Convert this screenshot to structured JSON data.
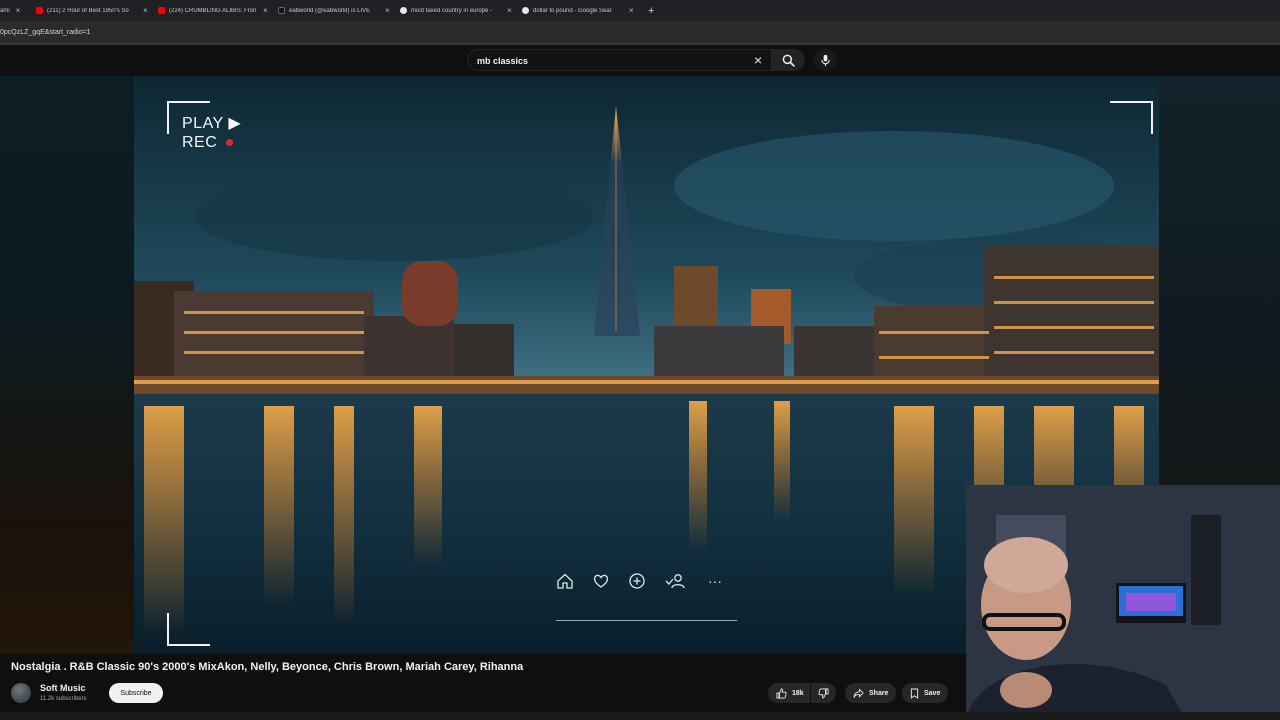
{
  "browser": {
    "tabs": [
      {
        "title": "ami",
        "favicon_color": "#c9c9c9",
        "close": "×"
      },
      {
        "title": "(211) 2 Hour of Best 1950's So",
        "favicon_color": "#ff0000",
        "close": "×"
      },
      {
        "title": "(224) CRUMBLING ALIBIS: Fron",
        "favicon_color": "#ff0000",
        "close": "×"
      },
      {
        "title": "eabworld (@eabworld) is LIVE",
        "favicon_color": "#111111",
        "close": "×"
      },
      {
        "title": "most taxed country in europe -",
        "favicon_color": "#e8e8e8",
        "close": "×"
      },
      {
        "title": "dollar to pound - Google Sear",
        "favicon_color": "#e8e8e8",
        "close": "×"
      }
    ],
    "new_tab": "+",
    "url": "0pcQzLZ_gqE&start_radio=1"
  },
  "youtube": {
    "search": {
      "value": "mb classics",
      "clear": "×",
      "search_icon": "search-icon",
      "mic_icon": "mic-icon"
    },
    "overlay": {
      "play_text": "PLAY ▶",
      "rec_text": "REC",
      "rec_dot_color": "#e0283a",
      "icons": [
        "home-icon",
        "heart-icon",
        "add-icon",
        "people-icon",
        "more-icon"
      ],
      "more_text": "···"
    },
    "video": {
      "title": "Nostalgia . R&B Classic 90's 2000's MixAkon, Nelly, Beyonce, Chris Brown, Mariah Carey, Rihanna",
      "channel": "Soft Music",
      "subscribers": "11.2k subscribers",
      "subscribe_label": "Subscribe",
      "likes": "18k",
      "share_label": "Share",
      "save_label": "Save"
    }
  },
  "colors": {
    "accent": "#f1f1f1",
    "bg": "#0f0f0f",
    "pill": "#272727"
  }
}
